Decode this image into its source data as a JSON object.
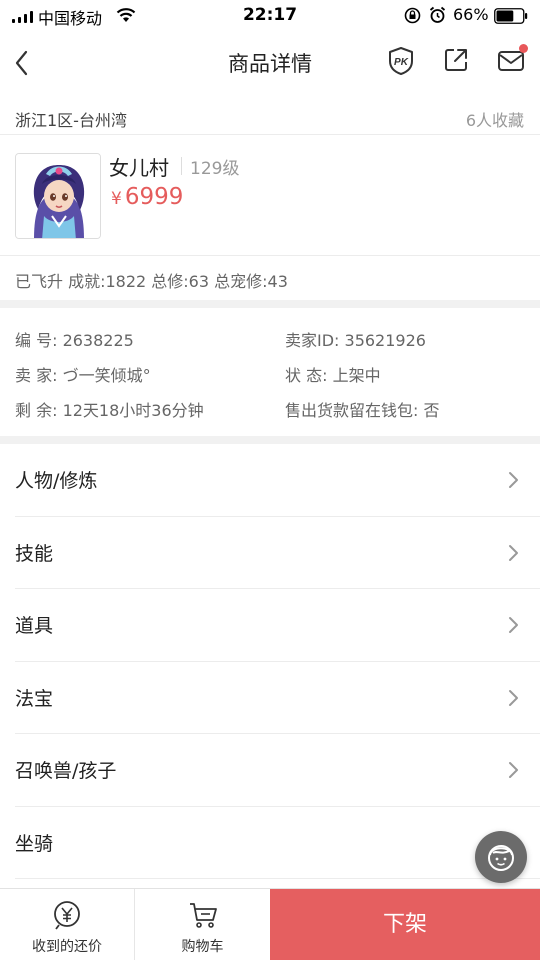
{
  "status_bar": {
    "carrier": "中国移动",
    "time": "22:17",
    "battery": "66%",
    "battery_level": 0.66
  },
  "nav": {
    "title": "商品详情",
    "accent": "#e8585a"
  },
  "listing": {
    "server": "浙江1区-台州湾",
    "favorites": "6人收藏"
  },
  "role": {
    "name": "女儿村",
    "level": "129级",
    "currency": "¥",
    "price": "6999",
    "price_color": "#e55c5c",
    "stats": "已飞升 成就:1822 总修:63 总宠修:43"
  },
  "info": {
    "id": "编  号: 2638225",
    "seller_id": "卖家ID: 35621926",
    "seller": "卖  家: づ一笑倾城°",
    "status": "状  态: 上架中",
    "remaining": "剩  余: 12天18小时36分钟",
    "wallet": "售出货款留在钱包: 否"
  },
  "menu": [
    {
      "label": "人物/修炼"
    },
    {
      "label": "技能"
    },
    {
      "label": "道具"
    },
    {
      "label": "法宝"
    },
    {
      "label": "召唤兽/孩子"
    },
    {
      "label": "坐骑"
    }
  ],
  "bottom_bar": {
    "offer_label": "收到的还价",
    "cart_label": "购物车",
    "delist_label": "下架",
    "delist_color": "#e55f60"
  },
  "icons": {
    "back": "chevron-left-icon",
    "pk": "pk-shield-icon",
    "share": "share-icon",
    "mail": "mail-icon",
    "offer": "yen-circle-icon",
    "cart": "cart-icon",
    "service": "customer-service-icon"
  }
}
